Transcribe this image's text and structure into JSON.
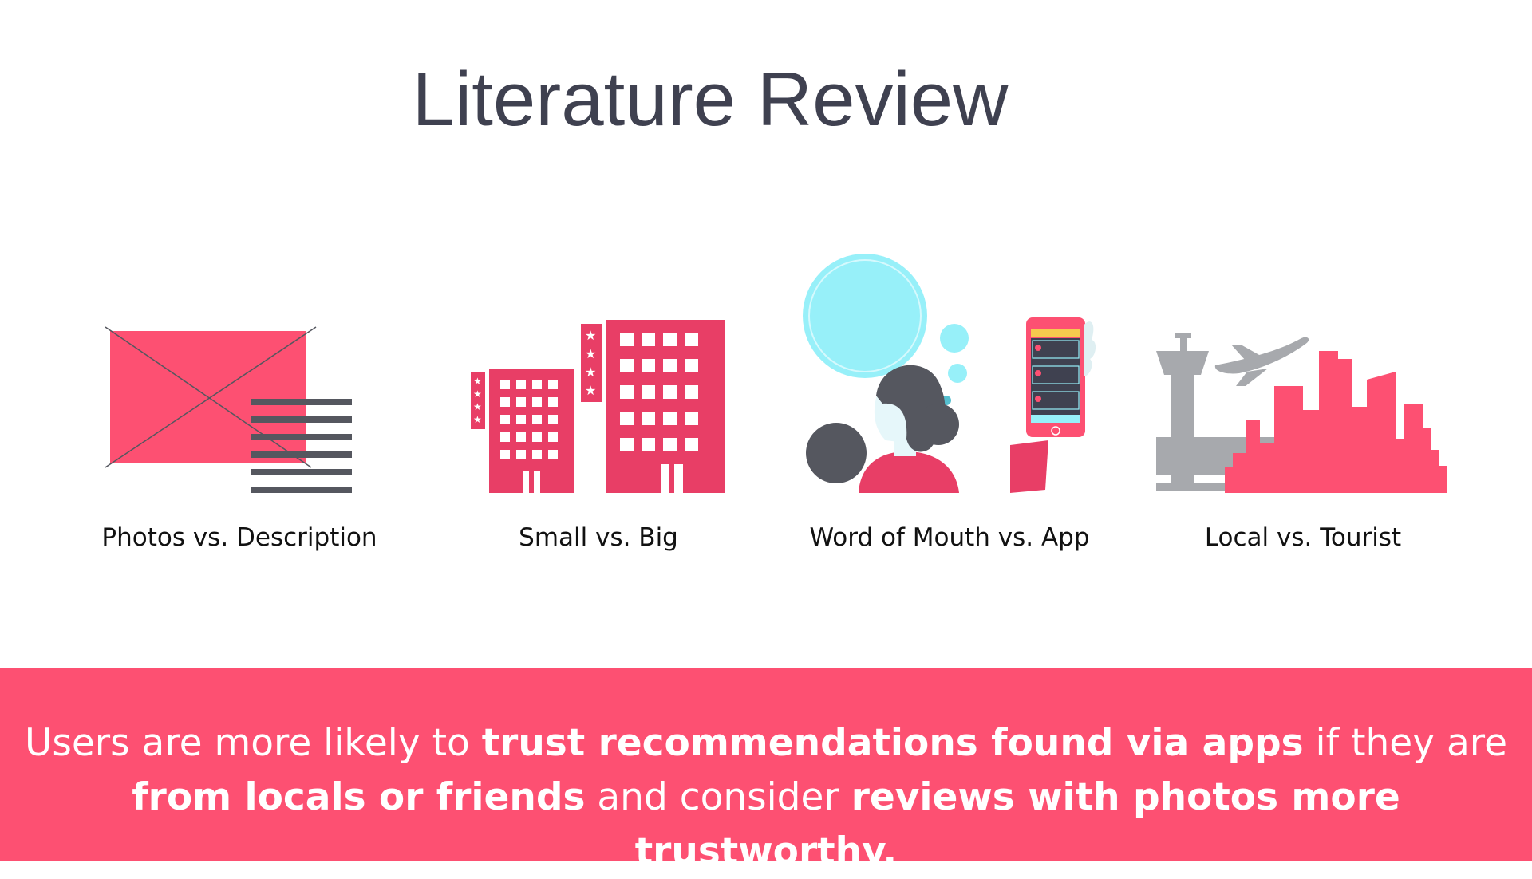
{
  "slide": {
    "title": "Literature Review",
    "items": [
      {
        "id": "photos",
        "label": "Photos vs. Description",
        "icon": "photo-description-icon"
      },
      {
        "id": "size",
        "label": "Small vs. Big",
        "icon": "hotel-buildings-icon"
      },
      {
        "id": "wom",
        "label": "Word of Mouth vs. App",
        "icon": "woman-phone-icon"
      },
      {
        "id": "local",
        "label": "Local vs. Tourist",
        "icon": "airport-city-icon"
      }
    ],
    "summary": {
      "line1": [
        {
          "text": "Users are more likely to ",
          "bold": false
        },
        {
          "text": "trust recommendations found via apps",
          "bold": true
        },
        {
          "text": " if they are",
          "bold": false
        }
      ],
      "line2": [
        {
          "text": "from locals or friends",
          "bold": true
        },
        {
          "text": " and consider ",
          "bold": false
        },
        {
          "text": "reviews with photos more trustworthy.",
          "bold": true
        }
      ]
    }
  },
  "colors": {
    "accent": "#fd5072",
    "building_pink": "#e83e66",
    "dark_gray": "#55575f",
    "light_gray": "#a7a9ad",
    "bubble_cyan": "#97f0f9",
    "title_gray": "#3f4150"
  }
}
